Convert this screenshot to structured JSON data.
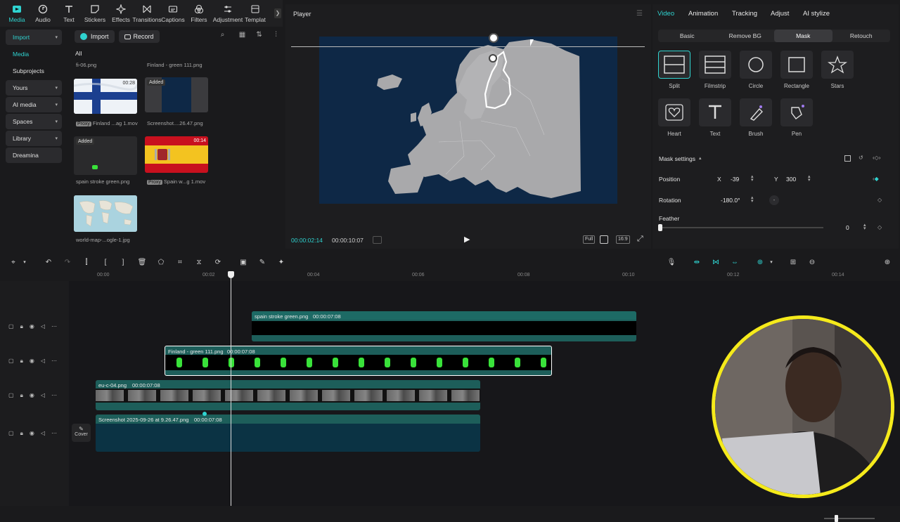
{
  "toolbar": {
    "tools": [
      {
        "label": "Media",
        "icon": "media-icon",
        "active": true
      },
      {
        "label": "Audio",
        "icon": "audio-icon"
      },
      {
        "label": "Text",
        "icon": "text-icon"
      },
      {
        "label": "Stickers",
        "icon": "stickers-icon"
      },
      {
        "label": "Effects",
        "icon": "effects-icon"
      },
      {
        "label": "Transitions",
        "icon": "transitions-icon"
      },
      {
        "label": "Captions",
        "icon": "captions-icon"
      },
      {
        "label": "Filters",
        "icon": "filters-icon"
      },
      {
        "label": "Adjustment",
        "icon": "adjustment-icon"
      },
      {
        "label": "Templat",
        "icon": "templates-icon"
      }
    ]
  },
  "sidebar": {
    "items": [
      {
        "label": "Import",
        "chevron": "▾"
      },
      {
        "label": "Media"
      },
      {
        "label": "Subprojects"
      },
      {
        "label": "Yours",
        "chevron": "▾"
      },
      {
        "label": "AI media",
        "chevron": "▾"
      },
      {
        "label": "Spaces",
        "chevron": "▾"
      },
      {
        "label": "Library",
        "chevron": "▾"
      },
      {
        "label": "Dreamina"
      }
    ]
  },
  "media": {
    "import_label": "Import",
    "record_label": "Record",
    "all_label": "All",
    "items": [
      {
        "caption": "fi-06.png"
      },
      {
        "caption": "Finland - green 111.png"
      },
      {
        "caption": "Finland ...ag 1.mov",
        "proxy": "Proxy",
        "duration": "00:28"
      },
      {
        "caption": "Screenshot....26.47.png",
        "badge": "Added"
      },
      {
        "caption": "spain stroke green.png",
        "badge": "Added"
      },
      {
        "caption": "Spain w...g 1.mov",
        "proxy": "Proxy",
        "duration": "00:14"
      },
      {
        "caption": "world-map-...ogle-1.jpg"
      }
    ]
  },
  "player": {
    "title": "Player",
    "current_time": "00:00:02:14",
    "total_time": "00:00:10:07",
    "controls": [
      "Full",
      "16:9"
    ]
  },
  "right_panel": {
    "tabs": [
      "Video",
      "Animation",
      "Tracking",
      "Adjust",
      "AI stylize"
    ],
    "subtabs": [
      "Basic",
      "Remove BG",
      "Mask",
      "Retouch"
    ],
    "masks": [
      "Split",
      "Filmstrip",
      "Circle",
      "Rectangle",
      "Stars",
      "Heart",
      "Text",
      "Brush",
      "Pen"
    ],
    "mask_settings_label": "Mask settings",
    "position_label": "Position",
    "x_label": "X",
    "x_value": "-39",
    "y_label": "Y",
    "y_value": "300",
    "rotation_label": "Rotation",
    "rotation_value": "-180.0°",
    "feather_label": "Feather",
    "feather_value": "0"
  },
  "timeline": {
    "ticks": [
      "00:00",
      "00:02",
      "00:04",
      "00:06",
      "00:08",
      "00:10",
      "00:12",
      "00:14"
    ],
    "clips": [
      {
        "name": "spain stroke green.png",
        "duration": "00:00:07:08"
      },
      {
        "name": "Finland - green 111.png",
        "duration": "00:00:07:08"
      },
      {
        "name": "eu-c-04.png",
        "duration": "00:00:07:08"
      },
      {
        "name": "Screenshot 2025-09-26 at 9.26.47.png",
        "duration": "00:00:07:08"
      }
    ],
    "cover_label": "Cover"
  },
  "colors": {
    "accent": "#2fd3d0",
    "clip_teal": "#1d5e5a",
    "map_bg": "#0e2846",
    "webcam_ring": "#f5ea1b"
  }
}
